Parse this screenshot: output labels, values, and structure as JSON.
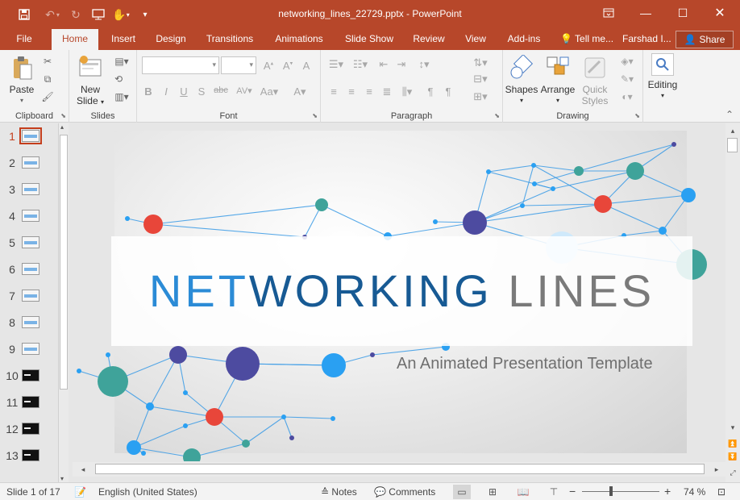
{
  "window": {
    "title": "networking_lines_22729.pptx - PowerPoint",
    "accent": "#b7472a"
  },
  "tabs": [
    {
      "label": "File",
      "active": false
    },
    {
      "label": "Home",
      "active": true
    },
    {
      "label": "Insert",
      "active": false
    },
    {
      "label": "Design",
      "active": false
    },
    {
      "label": "Transitions",
      "active": false
    },
    {
      "label": "Animations",
      "active": false
    },
    {
      "label": "Slide Show",
      "active": false
    },
    {
      "label": "Review",
      "active": false
    },
    {
      "label": "View",
      "active": false
    },
    {
      "label": "Add-ins",
      "active": false
    },
    {
      "label": "Tell me...",
      "active": false
    },
    {
      "label": "Farshad I...",
      "active": false
    }
  ],
  "share_label": "Share",
  "ribbon": {
    "clipboard": {
      "label": "Clipboard",
      "paste": "Paste"
    },
    "slides": {
      "label": "Slides",
      "new_slide_line1": "New",
      "new_slide_line2": "Slide"
    },
    "font": {
      "label": "Font",
      "font_name": "",
      "font_size": ""
    },
    "paragraph": {
      "label": "Paragraph"
    },
    "drawing": {
      "label": "Drawing",
      "shapes": "Shapes",
      "arrange": "Arrange",
      "quick_styles_line1": "Quick",
      "quick_styles_line2": "Styles"
    },
    "editing": {
      "label": "Editing"
    }
  },
  "thumbnails": {
    "selected": 1,
    "items": [
      {
        "num": "1",
        "dark": false
      },
      {
        "num": "2",
        "dark": false
      },
      {
        "num": "3",
        "dark": false
      },
      {
        "num": "4",
        "dark": false
      },
      {
        "num": "5",
        "dark": false
      },
      {
        "num": "6",
        "dark": false
      },
      {
        "num": "7",
        "dark": false
      },
      {
        "num": "8",
        "dark": false
      },
      {
        "num": "9",
        "dark": false
      },
      {
        "num": "10",
        "dark": true
      },
      {
        "num": "11",
        "dark": true
      },
      {
        "num": "12",
        "dark": true
      },
      {
        "num": "13",
        "dark": true
      }
    ]
  },
  "slide": {
    "title_part1": "NET",
    "title_part2": "WORKING ",
    "title_part3": "LINES",
    "subtitle": "An Animated Presentation Template",
    "colors": {
      "teal": "#3fa39a",
      "red": "#e8463a",
      "purple": "#4d4ba0",
      "blue": "#2aa0f2",
      "line": "#3a9be6"
    }
  },
  "status": {
    "slide_info": "Slide 1 of 17",
    "language": "English (United States)",
    "notes": "Notes",
    "comments": "Comments",
    "zoom": "74 %",
    "zoom_level": 0.74
  }
}
